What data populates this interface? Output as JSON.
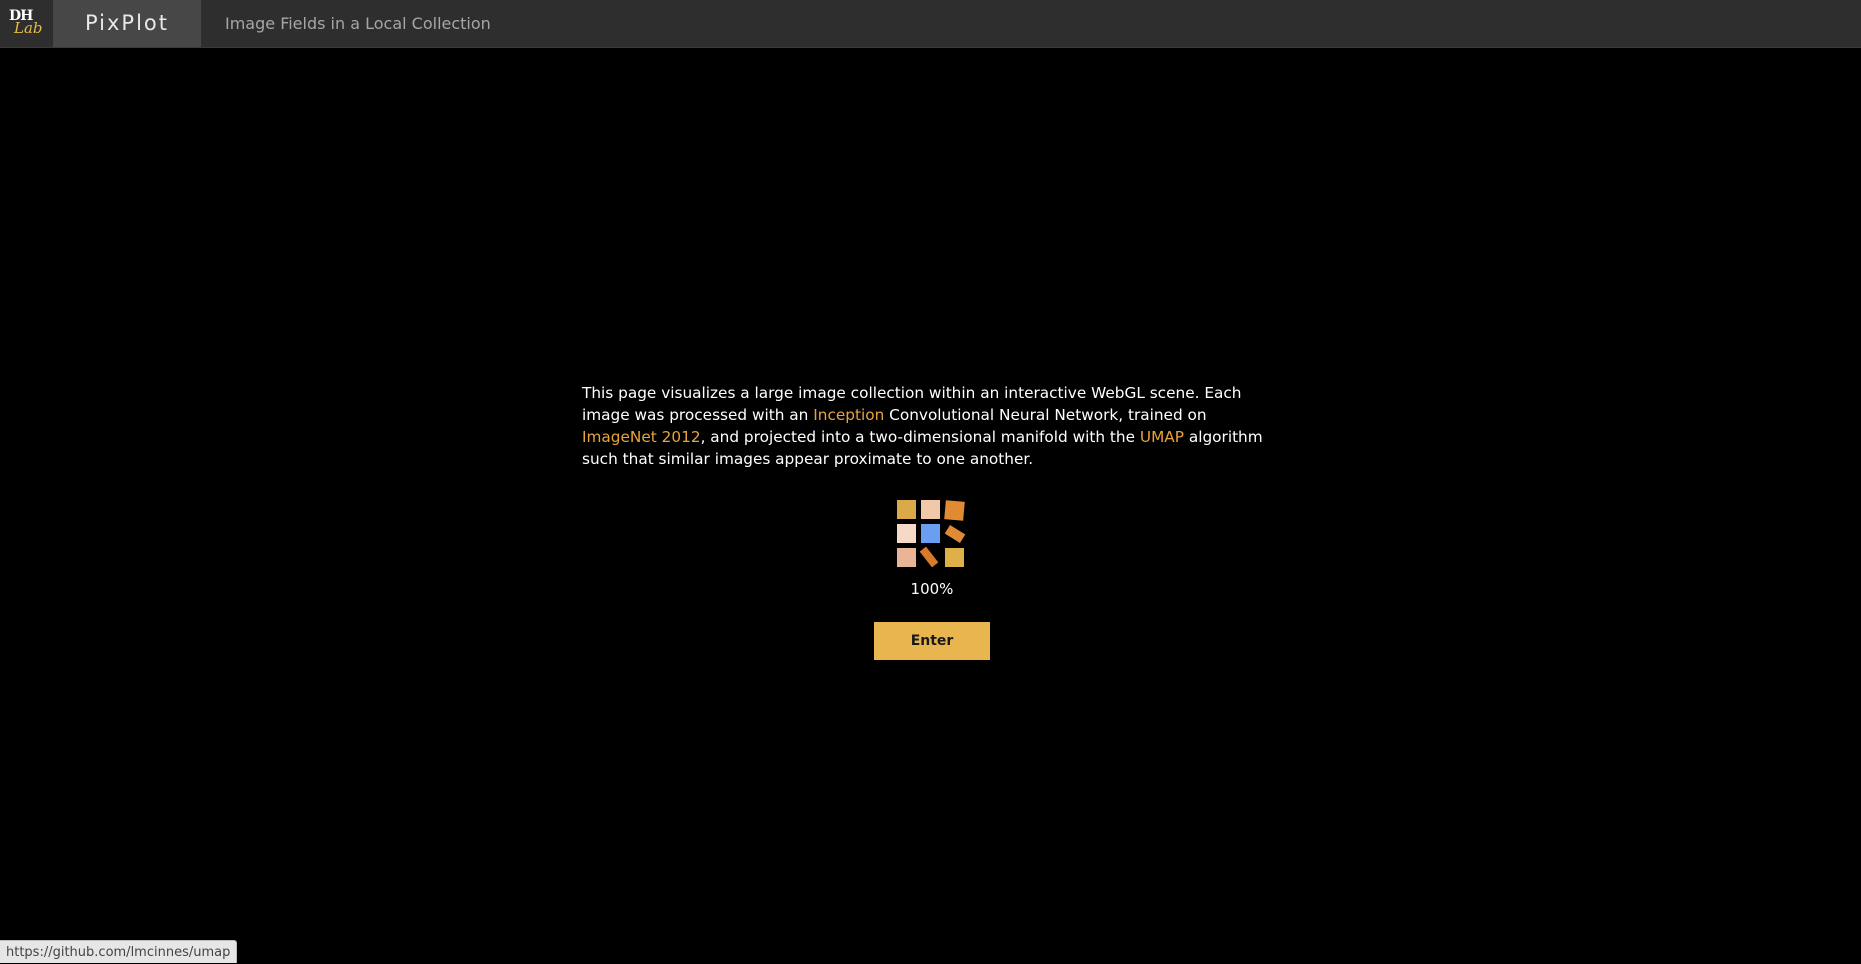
{
  "header": {
    "logo": {
      "line1": "DH",
      "line2": "Lab"
    },
    "app_name": "PixPlot",
    "page_title": "Image Fields in a Local Collection"
  },
  "intro": {
    "seg1": "This page visualizes a large image collection within an interactive WebGL scene. Each image was processed with an ",
    "link_inception": "Inception",
    "seg2": " Convolutional Neural Network, trained on ",
    "link_imagenet": "ImageNet 2012",
    "seg3": ", and projected into a two-dimensional manifold with the ",
    "link_umap": "UMAP",
    "seg4": " algorithm such that similar images appear proximate to one another."
  },
  "loader": {
    "progress_text": "100%",
    "progress_value": 1.0,
    "block_colors": [
      "#d9a94a",
      "#f2c9a8",
      "#e08b34",
      "#f6d9c6",
      "#6a9ef0",
      "#e08b34",
      "#eab496",
      "#d9792a",
      "#e0b048"
    ]
  },
  "enter_button": {
    "label": "Enter"
  },
  "status_bar": {
    "url": "https://github.com/lmcinnes/umap"
  },
  "colors": {
    "accent": "#e8b54f",
    "link": "#e8a33d",
    "topbar": "#2e2e2e",
    "background": "#000000"
  }
}
